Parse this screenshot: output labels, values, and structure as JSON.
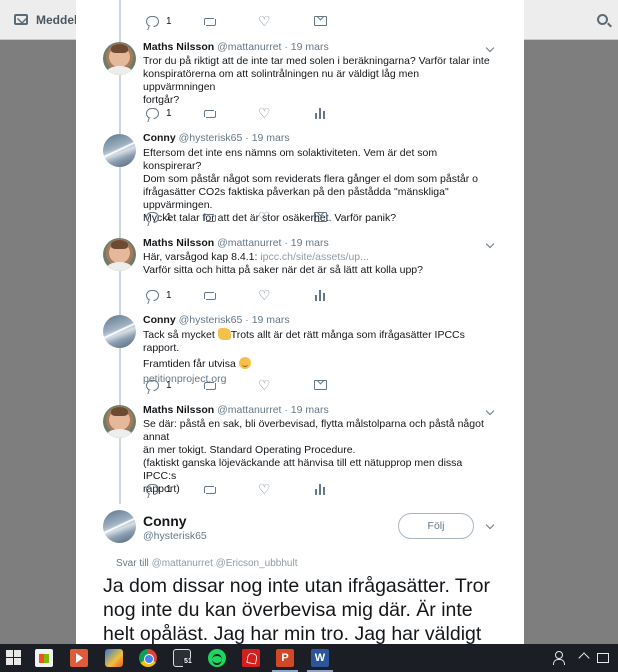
{
  "background": {
    "messages_label": "Meddela"
  },
  "colors": {
    "text": "#14171a",
    "muted": "#657786",
    "link": "#8d9ba6",
    "follow_border": "#a7b6c2",
    "thread_line": "#ccd6dd"
  },
  "tweets": [
    {
      "name": "",
      "handle": "",
      "date": "",
      "text": [],
      "actions": {
        "reply_count": "1",
        "stats": false
      }
    },
    {
      "name": "Maths Nilsson",
      "handle": "@mattanurret",
      "date": "· 19 mars",
      "text": [
        "Tror du på riktigt att de inte tar med solen i beräkningarna? Varför talar inte",
        "konspiratörerna om att solintrålningen nu är väldigt låg men uppvärmningen",
        "fortgår?"
      ],
      "actions": {
        "reply_count": "1",
        "stats": true
      }
    },
    {
      "name": "Conny",
      "handle": "@hysterisk65",
      "date": "· 19 mars",
      "text": [
        "Eftersom det inte ens nämns om solaktiviteten. Vem är det som konspirerar?",
        "Dom som påstår något som reviderats flera gånger el dom som påstår o",
        "ifrågasätter CO2s faktiska påverkan på den påstådda \"mänskliga\" uppvärmingen.",
        "Mycket talar för att det är stor osäkerhet. Varför panik?"
      ],
      "actions": {
        "reply_count": "1",
        "stats": false
      }
    },
    {
      "name": "Maths Nilsson",
      "handle": "@mattanurret",
      "date": "· 19 mars",
      "text_prefix": "Här, varsågod kap 8.4.1: ",
      "text_link": "ipcc.ch/site/assets/up...",
      "text": [
        "Varför sitta och hitta på saker när det är så lätt att kolla upp?"
      ],
      "actions": {
        "reply_count": "1",
        "stats": true
      }
    },
    {
      "name": "Conny",
      "handle": "@hysterisk65",
      "date": "· 19 mars",
      "text_line1_a": "Tack så mycket ",
      "text_line1_b": "Trots allt är det rätt många som ifrågasätter IPCCs rapport.",
      "text_line2": "Framtiden får utvisa ",
      "text_link": "petitionproject.org",
      "actions": {
        "reply_count": "1",
        "stats": false
      }
    },
    {
      "name": "Maths Nilsson",
      "handle": "@mattanurret",
      "date": "· 19 mars",
      "text": [
        "Se där: påstå en sak, bli överbevisad, flytta målstolparna och påstå något annat",
        "än mer tokigt. Standard Operating Procedure.",
        "(faktiskt ganska löjeväckande att hänvisa till ett nätupprop men dissa IPCC:s",
        "rapport)"
      ],
      "actions": {
        "reply_count": "1",
        "stats": true
      }
    }
  ],
  "main_tweet": {
    "name": "Conny",
    "handle": "@hysterisk65",
    "follow_label": "Följ",
    "reply_to_prefix": "Svar till ",
    "reply_to_users": "@mattanurret @Ericson_ubbhult",
    "text": [
      "Ja dom dissar nog inte utan ifrågasätter. Tror",
      "nog inte du kan överbevisa mig där. Är inte",
      "helt opåläst. Jag har min tro. Jag har väldigt"
    ]
  },
  "taskbar": {
    "apps": [
      "start",
      "store",
      "media",
      "paint",
      "chrome",
      "camera",
      "spotify",
      "acrobat",
      "powerpoint",
      "word"
    ],
    "camera_badge": "51",
    "ppt_letter": "P",
    "word_letter": "W"
  }
}
